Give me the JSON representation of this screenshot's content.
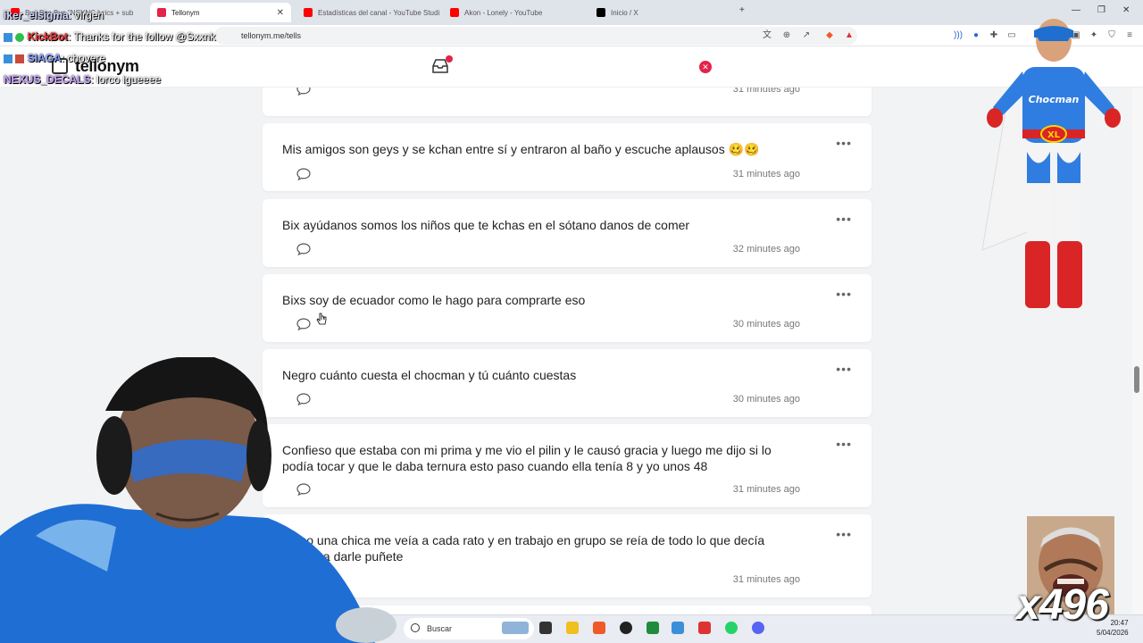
{
  "browser": {
    "tabs": [
      {
        "label": "Bye Bye Bye \"NSYNC lyrics + sub",
        "favicon_color": "#ff0000",
        "active": false
      },
      {
        "label": "Tellonym",
        "favicon_color": "#e4234a",
        "active": true
      },
      {
        "label": "Estadísticas del canal - YouTube Studi",
        "favicon_color": "#ff0000",
        "active": false
      },
      {
        "label": "Akon - Lonely - YouTube",
        "favicon_color": "#ff0000",
        "active": false
      },
      {
        "label": "Inicio / X",
        "favicon_color": "#000000",
        "active": false
      }
    ],
    "url": "tellonym.me/tells",
    "new_tab": "+"
  },
  "site": {
    "logo": "tellonym",
    "accent_color": "#e4234a"
  },
  "tells": [
    {
      "text": "",
      "time": "31 minutes ago"
    },
    {
      "text": "Mis amigos son geys y se kchan entre sí y entraron al baño y escuche aplausos 🥴🥴",
      "time": "31 minutes ago"
    },
    {
      "text": "Bix ayúdanos somos los niños que te kchas en el sótano danos de comer",
      "time": "32 minutes ago"
    },
    {
      "text": "Bixs soy de ecuador como le hago para comprarte eso",
      "time": "30 minutes ago"
    },
    {
      "text": "Negro cuánto cuesta el chocman y tú cuánto cuestas",
      "time": "30 minutes ago"
    },
    {
      "text": "Confieso que estaba con mi prima y me vio el pilin y le causó gracia y luego me dijo si lo podía tocar y que le daba ternura esto paso cuando ella tenía 8 y yo unos 48",
      "time": "31 minutes ago"
    },
    {
      "text": "Mano una chica me veía a cada rato y en trabajo en grupo se reía de todo lo que decía pensaba darle puñete",
      "time": "31 minutes ago"
    }
  ],
  "stream_chat": [
    {
      "user": "iker_elsigma",
      "message": ": virgen",
      "user_color": "#cfd6ff"
    },
    {
      "user": "KickBot",
      "message": ": Thanks for the follow @Sxxnk",
      "user_color": "#ff4040"
    },
    {
      "user": "SIAGA",
      "message": ": chovere",
      "user_color": "#8aa0ff"
    },
    {
      "user": "NEXUS_DECALS",
      "message": ": lorco igueeee",
      "user_color": "#c7a4ff"
    }
  ],
  "overlay": {
    "hero_badge": "Chocman",
    "hero_belt": "XL",
    "meme_counter": "x496"
  },
  "taskbar": {
    "search_placeholder": "Buscar",
    "time": "20:47",
    "date": "5/04/2026"
  }
}
